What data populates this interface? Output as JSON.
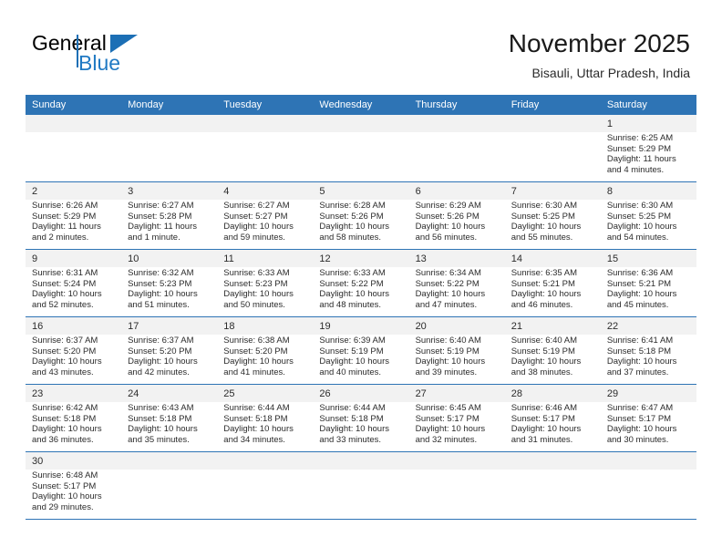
{
  "logo": {
    "text_primary": "General",
    "text_secondary": "Blue",
    "primary_color": "#000000",
    "secondary_color": "#2079c3",
    "accent_color": "#1c6fb5"
  },
  "header": {
    "title": "November 2025",
    "location": "Bisauli, Uttar Pradesh, India"
  },
  "theme": {
    "header_blue": "#2e74b5",
    "band_gray": "#f2f2f2",
    "text_color": "#2b2b2b"
  },
  "weekdays": [
    "Sunday",
    "Monday",
    "Tuesday",
    "Wednesday",
    "Thursday",
    "Friday",
    "Saturday"
  ],
  "weeks": [
    [
      {
        "day": "",
        "sunrise": "",
        "sunset": "",
        "daylight_line1": "",
        "daylight_line2": ""
      },
      {
        "day": "",
        "sunrise": "",
        "sunset": "",
        "daylight_line1": "",
        "daylight_line2": ""
      },
      {
        "day": "",
        "sunrise": "",
        "sunset": "",
        "daylight_line1": "",
        "daylight_line2": ""
      },
      {
        "day": "",
        "sunrise": "",
        "sunset": "",
        "daylight_line1": "",
        "daylight_line2": ""
      },
      {
        "day": "",
        "sunrise": "",
        "sunset": "",
        "daylight_line1": "",
        "daylight_line2": ""
      },
      {
        "day": "",
        "sunrise": "",
        "sunset": "",
        "daylight_line1": "",
        "daylight_line2": ""
      },
      {
        "day": "1",
        "sunrise": "Sunrise: 6:25 AM",
        "sunset": "Sunset: 5:29 PM",
        "daylight_line1": "Daylight: 11 hours",
        "daylight_line2": "and 4 minutes."
      }
    ],
    [
      {
        "day": "2",
        "sunrise": "Sunrise: 6:26 AM",
        "sunset": "Sunset: 5:29 PM",
        "daylight_line1": "Daylight: 11 hours",
        "daylight_line2": "and 2 minutes."
      },
      {
        "day": "3",
        "sunrise": "Sunrise: 6:27 AM",
        "sunset": "Sunset: 5:28 PM",
        "daylight_line1": "Daylight: 11 hours",
        "daylight_line2": "and 1 minute."
      },
      {
        "day": "4",
        "sunrise": "Sunrise: 6:27 AM",
        "sunset": "Sunset: 5:27 PM",
        "daylight_line1": "Daylight: 10 hours",
        "daylight_line2": "and 59 minutes."
      },
      {
        "day": "5",
        "sunrise": "Sunrise: 6:28 AM",
        "sunset": "Sunset: 5:26 PM",
        "daylight_line1": "Daylight: 10 hours",
        "daylight_line2": "and 58 minutes."
      },
      {
        "day": "6",
        "sunrise": "Sunrise: 6:29 AM",
        "sunset": "Sunset: 5:26 PM",
        "daylight_line1": "Daylight: 10 hours",
        "daylight_line2": "and 56 minutes."
      },
      {
        "day": "7",
        "sunrise": "Sunrise: 6:30 AM",
        "sunset": "Sunset: 5:25 PM",
        "daylight_line1": "Daylight: 10 hours",
        "daylight_line2": "and 55 minutes."
      },
      {
        "day": "8",
        "sunrise": "Sunrise: 6:30 AM",
        "sunset": "Sunset: 5:25 PM",
        "daylight_line1": "Daylight: 10 hours",
        "daylight_line2": "and 54 minutes."
      }
    ],
    [
      {
        "day": "9",
        "sunrise": "Sunrise: 6:31 AM",
        "sunset": "Sunset: 5:24 PM",
        "daylight_line1": "Daylight: 10 hours",
        "daylight_line2": "and 52 minutes."
      },
      {
        "day": "10",
        "sunrise": "Sunrise: 6:32 AM",
        "sunset": "Sunset: 5:23 PM",
        "daylight_line1": "Daylight: 10 hours",
        "daylight_line2": "and 51 minutes."
      },
      {
        "day": "11",
        "sunrise": "Sunrise: 6:33 AM",
        "sunset": "Sunset: 5:23 PM",
        "daylight_line1": "Daylight: 10 hours",
        "daylight_line2": "and 50 minutes."
      },
      {
        "day": "12",
        "sunrise": "Sunrise: 6:33 AM",
        "sunset": "Sunset: 5:22 PM",
        "daylight_line1": "Daylight: 10 hours",
        "daylight_line2": "and 48 minutes."
      },
      {
        "day": "13",
        "sunrise": "Sunrise: 6:34 AM",
        "sunset": "Sunset: 5:22 PM",
        "daylight_line1": "Daylight: 10 hours",
        "daylight_line2": "and 47 minutes."
      },
      {
        "day": "14",
        "sunrise": "Sunrise: 6:35 AM",
        "sunset": "Sunset: 5:21 PM",
        "daylight_line1": "Daylight: 10 hours",
        "daylight_line2": "and 46 minutes."
      },
      {
        "day": "15",
        "sunrise": "Sunrise: 6:36 AM",
        "sunset": "Sunset: 5:21 PM",
        "daylight_line1": "Daylight: 10 hours",
        "daylight_line2": "and 45 minutes."
      }
    ],
    [
      {
        "day": "16",
        "sunrise": "Sunrise: 6:37 AM",
        "sunset": "Sunset: 5:20 PM",
        "daylight_line1": "Daylight: 10 hours",
        "daylight_line2": "and 43 minutes."
      },
      {
        "day": "17",
        "sunrise": "Sunrise: 6:37 AM",
        "sunset": "Sunset: 5:20 PM",
        "daylight_line1": "Daylight: 10 hours",
        "daylight_line2": "and 42 minutes."
      },
      {
        "day": "18",
        "sunrise": "Sunrise: 6:38 AM",
        "sunset": "Sunset: 5:20 PM",
        "daylight_line1": "Daylight: 10 hours",
        "daylight_line2": "and 41 minutes."
      },
      {
        "day": "19",
        "sunrise": "Sunrise: 6:39 AM",
        "sunset": "Sunset: 5:19 PM",
        "daylight_line1": "Daylight: 10 hours",
        "daylight_line2": "and 40 minutes."
      },
      {
        "day": "20",
        "sunrise": "Sunrise: 6:40 AM",
        "sunset": "Sunset: 5:19 PM",
        "daylight_line1": "Daylight: 10 hours",
        "daylight_line2": "and 39 minutes."
      },
      {
        "day": "21",
        "sunrise": "Sunrise: 6:40 AM",
        "sunset": "Sunset: 5:19 PM",
        "daylight_line1": "Daylight: 10 hours",
        "daylight_line2": "and 38 minutes."
      },
      {
        "day": "22",
        "sunrise": "Sunrise: 6:41 AM",
        "sunset": "Sunset: 5:18 PM",
        "daylight_line1": "Daylight: 10 hours",
        "daylight_line2": "and 37 minutes."
      }
    ],
    [
      {
        "day": "23",
        "sunrise": "Sunrise: 6:42 AM",
        "sunset": "Sunset: 5:18 PM",
        "daylight_line1": "Daylight: 10 hours",
        "daylight_line2": "and 36 minutes."
      },
      {
        "day": "24",
        "sunrise": "Sunrise: 6:43 AM",
        "sunset": "Sunset: 5:18 PM",
        "daylight_line1": "Daylight: 10 hours",
        "daylight_line2": "and 35 minutes."
      },
      {
        "day": "25",
        "sunrise": "Sunrise: 6:44 AM",
        "sunset": "Sunset: 5:18 PM",
        "daylight_line1": "Daylight: 10 hours",
        "daylight_line2": "and 34 minutes."
      },
      {
        "day": "26",
        "sunrise": "Sunrise: 6:44 AM",
        "sunset": "Sunset: 5:18 PM",
        "daylight_line1": "Daylight: 10 hours",
        "daylight_line2": "and 33 minutes."
      },
      {
        "day": "27",
        "sunrise": "Sunrise: 6:45 AM",
        "sunset": "Sunset: 5:17 PM",
        "daylight_line1": "Daylight: 10 hours",
        "daylight_line2": "and 32 minutes."
      },
      {
        "day": "28",
        "sunrise": "Sunrise: 6:46 AM",
        "sunset": "Sunset: 5:17 PM",
        "daylight_line1": "Daylight: 10 hours",
        "daylight_line2": "and 31 minutes."
      },
      {
        "day": "29",
        "sunrise": "Sunrise: 6:47 AM",
        "sunset": "Sunset: 5:17 PM",
        "daylight_line1": "Daylight: 10 hours",
        "daylight_line2": "and 30 minutes."
      }
    ],
    [
      {
        "day": "30",
        "sunrise": "Sunrise: 6:48 AM",
        "sunset": "Sunset: 5:17 PM",
        "daylight_line1": "Daylight: 10 hours",
        "daylight_line2": "and 29 minutes."
      },
      {
        "day": "",
        "sunrise": "",
        "sunset": "",
        "daylight_line1": "",
        "daylight_line2": ""
      },
      {
        "day": "",
        "sunrise": "",
        "sunset": "",
        "daylight_line1": "",
        "daylight_line2": ""
      },
      {
        "day": "",
        "sunrise": "",
        "sunset": "",
        "daylight_line1": "",
        "daylight_line2": ""
      },
      {
        "day": "",
        "sunrise": "",
        "sunset": "",
        "daylight_line1": "",
        "daylight_line2": ""
      },
      {
        "day": "",
        "sunrise": "",
        "sunset": "",
        "daylight_line1": "",
        "daylight_line2": ""
      },
      {
        "day": "",
        "sunrise": "",
        "sunset": "",
        "daylight_line1": "",
        "daylight_line2": ""
      }
    ]
  ]
}
